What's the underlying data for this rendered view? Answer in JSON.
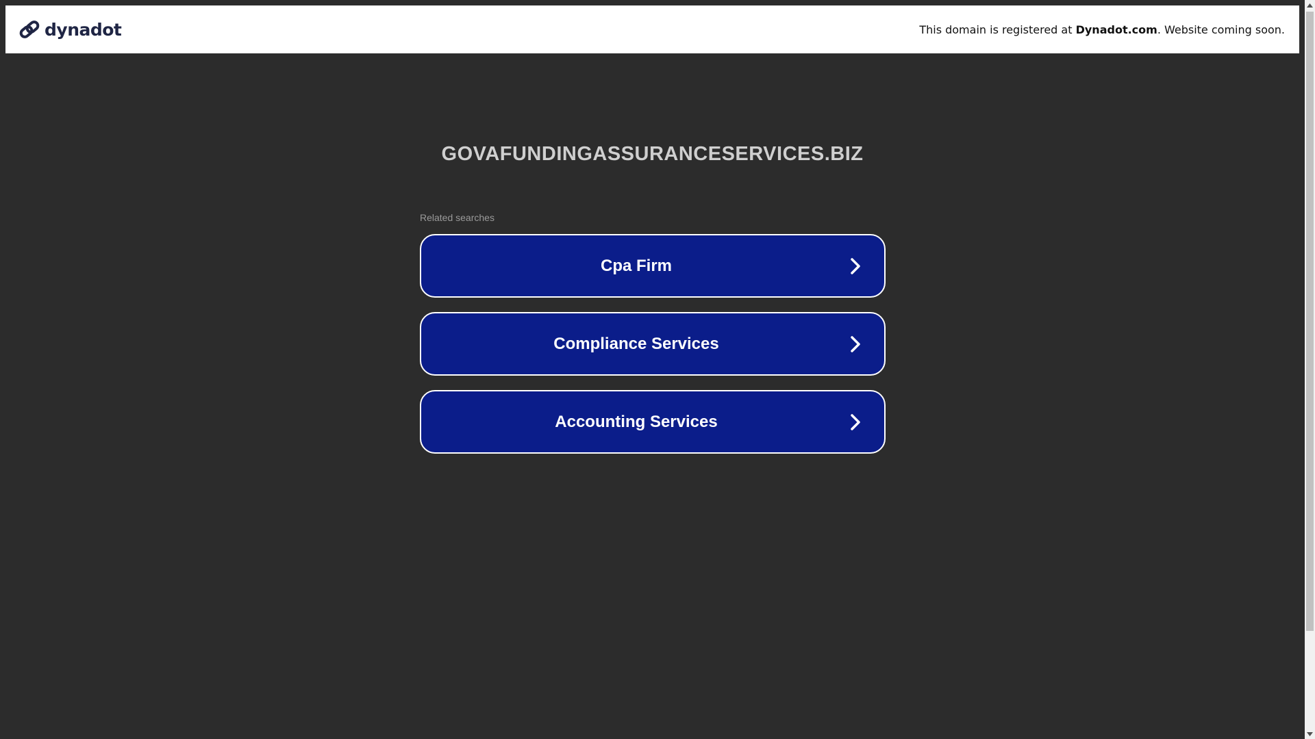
{
  "header": {
    "logo_text": "dynadot",
    "notice_prefix": "This domain is registered at",
    "notice_brand": "Dynadot.com",
    "notice_suffix": ". Website coming soon."
  },
  "main": {
    "domain": "GOVAFUNDINGASSURANCESERVICES.BIZ",
    "related_label": "Related searches",
    "links": [
      {
        "label": "Cpa Firm",
        "icon": "chevron-right-icon"
      },
      {
        "label": "Compliance Services",
        "icon": "chevron-right-icon"
      },
      {
        "label": "Accounting Services",
        "icon": "chevron-right-icon"
      }
    ]
  },
  "colors": {
    "background": "#2c2c2c",
    "button": "#0b1d8a",
    "brand": "#1f2544"
  }
}
